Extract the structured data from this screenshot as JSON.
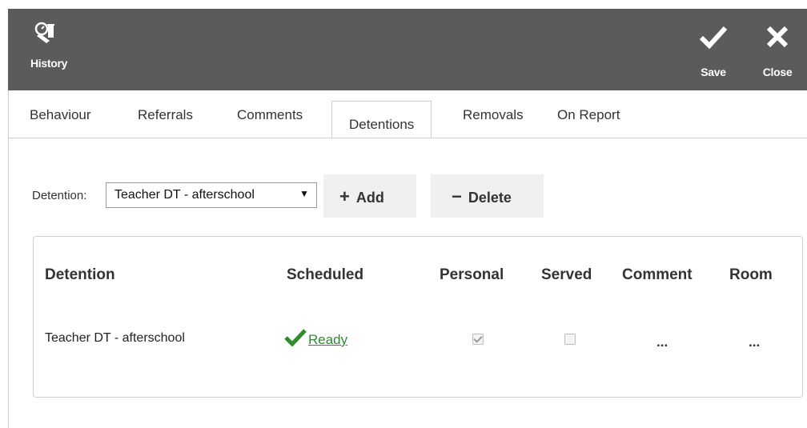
{
  "toolbar": {
    "history_label": "History",
    "history_icon": "history-icon",
    "save_label": "Save",
    "close_label": "Close",
    "background_color": "#5b5b5b"
  },
  "tabs": [
    {
      "label": "Behaviour",
      "active": false
    },
    {
      "label": "Referrals",
      "active": false
    },
    {
      "label": "Comments",
      "active": false
    },
    {
      "label": "Detentions",
      "active": true
    },
    {
      "label": "Removals",
      "active": false
    },
    {
      "label": "On Report",
      "active": false
    }
  ],
  "filter": {
    "label": "Detention:",
    "selected": "Teacher DT - afterschool",
    "add_label": "Add",
    "delete_label": "Delete"
  },
  "table": {
    "headers": [
      "Detention",
      "Scheduled",
      "Personal",
      "Served",
      "Comment",
      "Room"
    ],
    "rows": [
      {
        "detention": "Teacher DT - afterschool",
        "scheduled": "Ready",
        "personal": true,
        "served": false,
        "comment": "...",
        "room": "..."
      }
    ]
  },
  "colors": {
    "ready_green": "#2e8b2e"
  }
}
